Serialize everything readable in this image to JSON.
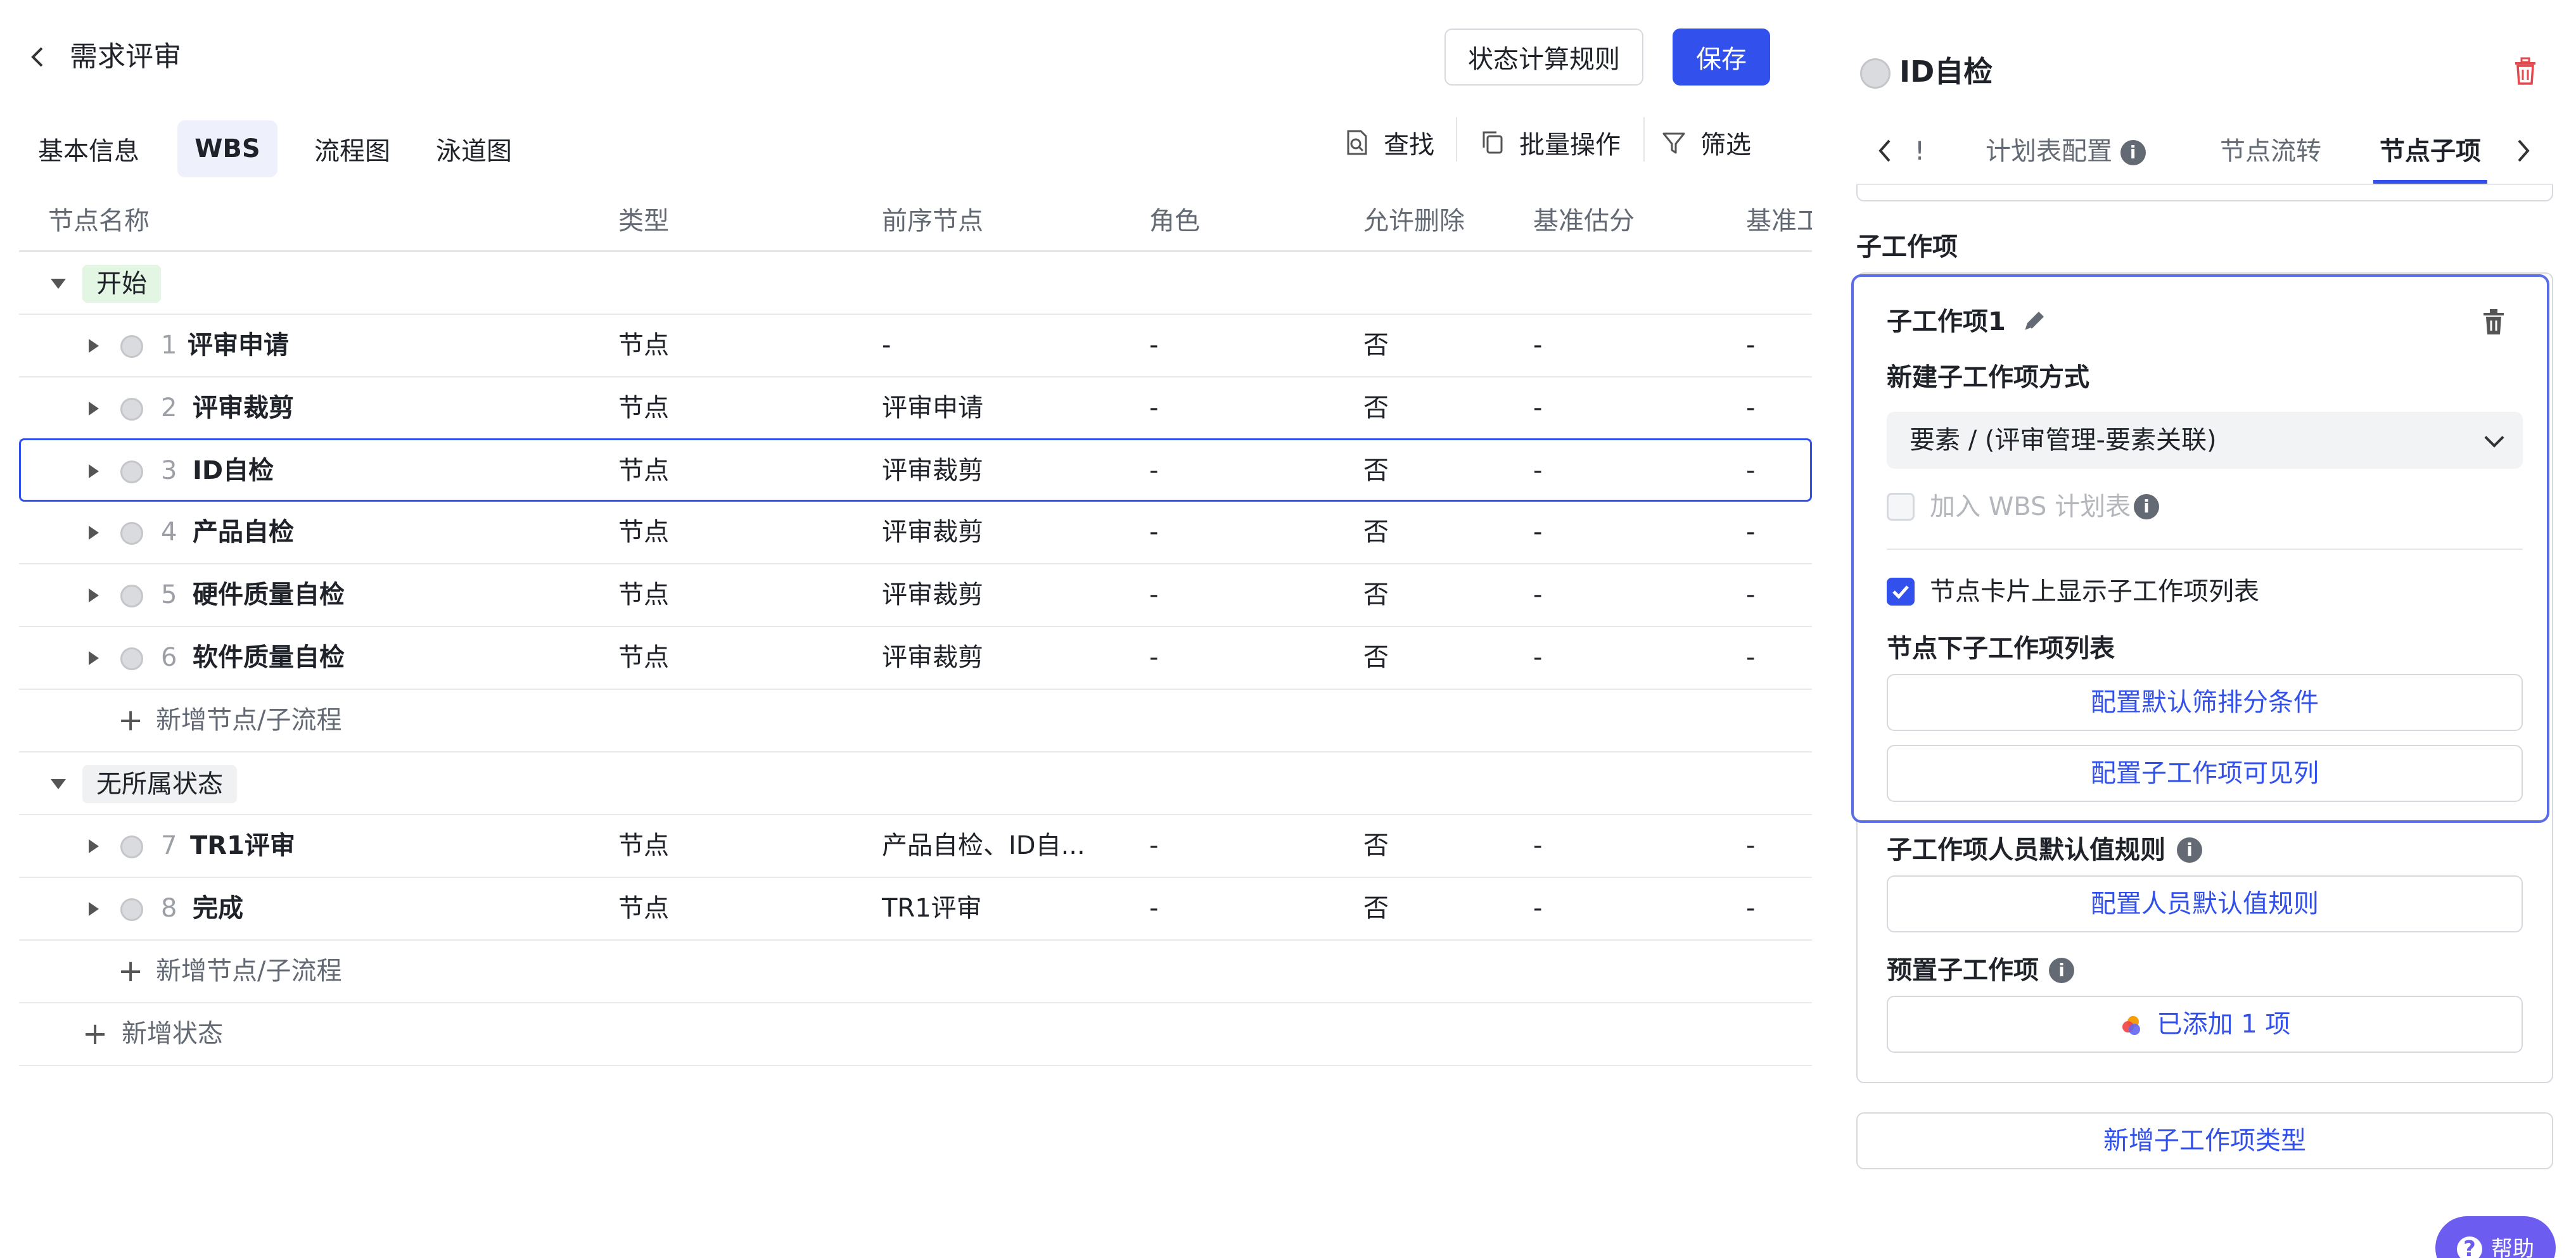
{
  "header": {
    "title": "需求评审",
    "rule_button": "状态计算规则",
    "save_button": "保存"
  },
  "view_tabs": [
    "基本信息",
    "WBS",
    "流程图",
    "泳道图"
  ],
  "active_view_tab": "WBS",
  "toolbar": {
    "find": "查找",
    "batch": "批量操作",
    "filter": "筛选"
  },
  "table": {
    "columns": [
      "节点名称",
      "类型",
      "前序节点",
      "角色",
      "允许删除",
      "基准估分",
      "基准工"
    ],
    "groups": [
      {
        "label": "开始",
        "color": "#e3f5e3",
        "rows": [
          {
            "num": "1",
            "name": "评审申请",
            "type": "节点",
            "prev": "-",
            "role": "-",
            "deletable": "否",
            "estimate": "-",
            "base": "-"
          },
          {
            "num": "2",
            "name": "评审裁剪",
            "type": "节点",
            "prev": "评审申请",
            "role": "-",
            "deletable": "否",
            "estimate": "-",
            "base": "-"
          },
          {
            "num": "3",
            "name": "ID自检",
            "type": "节点",
            "prev": "评审裁剪",
            "role": "-",
            "deletable": "否",
            "estimate": "-",
            "base": "-"
          },
          {
            "num": "4",
            "name": "产品自检",
            "type": "节点",
            "prev": "评审裁剪",
            "role": "-",
            "deletable": "否",
            "estimate": "-",
            "base": "-"
          },
          {
            "num": "5",
            "name": "硬件质量自检",
            "type": "节点",
            "prev": "评审裁剪",
            "role": "-",
            "deletable": "否",
            "estimate": "-",
            "base": "-"
          },
          {
            "num": "6",
            "name": "软件质量自检",
            "type": "节点",
            "prev": "评审裁剪",
            "role": "-",
            "deletable": "否",
            "estimate": "-",
            "base": "-"
          }
        ],
        "add_label": "新增节点/子流程"
      },
      {
        "label": "无所属状态",
        "color": "#f0f1f2",
        "rows": [
          {
            "num": "7",
            "name": "TR1评审",
            "type": "节点",
            "prev": "产品自检、ID自...",
            "role": "-",
            "deletable": "否",
            "estimate": "-",
            "base": "-"
          },
          {
            "num": "8",
            "name": "完成",
            "type": "节点",
            "prev": "TR1评审",
            "role": "-",
            "deletable": "否",
            "estimate": "-",
            "base": "-"
          }
        ],
        "add_label": "新增节点/子流程"
      }
    ],
    "add_state": "新增状态"
  },
  "panel": {
    "title": "ID自检",
    "tabs": [
      "!",
      "计划表配置",
      "节点流转",
      "节点子项"
    ],
    "active_tab": "节点子项",
    "section_title": "子工作项",
    "item_title": "子工作项1",
    "create_mode_label": "新建子工作项方式",
    "create_mode_value": "要素 / (评审管理-要素关联)",
    "add_wbs_label": "加入 WBS 计划表",
    "show_list_label": "节点卡片上显示子工作项列表",
    "list_label": "节点下子工作项列表",
    "config_filter": "配置默认筛排分条件",
    "config_columns": "配置子工作项可见列",
    "people_rule_label": "子工作项人员默认值规则",
    "config_people": "配置人员默认值规则",
    "preset_label": "预置子工作项",
    "preset_value": "已添加 1 项",
    "add_type": "新增子工作项类型",
    "help": "帮助"
  },
  "colors": {
    "accent": "#3250eb",
    "focus_border": "#5a6de6",
    "delete": "#e5484d"
  }
}
